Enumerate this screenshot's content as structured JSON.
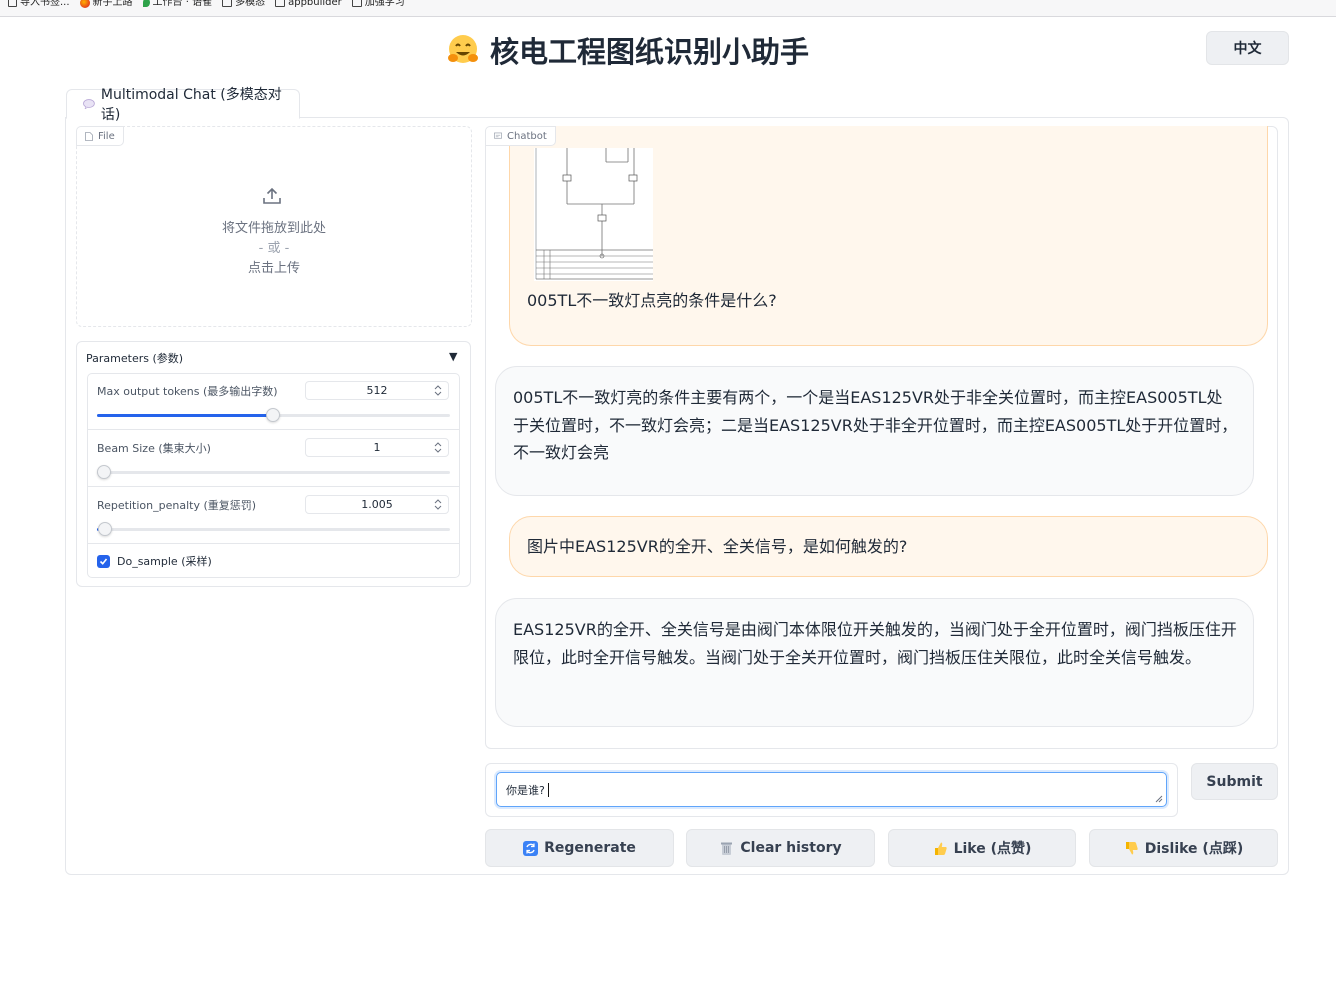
{
  "bookmarks": [
    {
      "label": "导入书签...",
      "icon": "import-icon"
    },
    {
      "label": "新手上路",
      "icon": "firefox-icon"
    },
    {
      "label": "工作台 · 语雀",
      "icon": "leaf-icon"
    },
    {
      "label": "多模态",
      "icon": "folder-icon"
    },
    {
      "label": "appbuilder",
      "icon": "folder-icon"
    },
    {
      "label": "加强学习",
      "icon": "folder-icon"
    }
  ],
  "header": {
    "title": "核电工程图纸识别小助手",
    "icon": "hugging-face-emoji-icon",
    "lang_button": "中文"
  },
  "tab": {
    "label": "Multimodal Chat (多模态对话)",
    "icon": "speech-bubble-icon"
  },
  "file_upload": {
    "label": "File",
    "drop_text": "将文件拖放到此处",
    "or_text": "- 或 -",
    "click_text": "点击上传"
  },
  "parameters": {
    "title": "Parameters (参数)",
    "max_tokens": {
      "label": "Max output tokens (最多输出字数)",
      "value": "512",
      "fraction": 0.5
    },
    "beam_size": {
      "label": "Beam Size (集束大小)",
      "value": "1",
      "fraction": 0.0
    },
    "repetition_penalty": {
      "label": "Repetition_penalty (重复惩罚)",
      "value": "1.005",
      "fraction": 0.005
    },
    "do_sample": {
      "label": "Do_sample (采样)",
      "checked": true
    }
  },
  "chatbot": {
    "label": "Chatbot",
    "messages": [
      {
        "role": "user",
        "text": "005TL不一致灯点亮的条件是什么?"
      },
      {
        "role": "bot",
        "text": "005TL不一致灯亮的条件主要有两个，一个是当EAS125VR处于非全关位置时，而主控EAS005TL处于关位置时，不一致灯会亮；二是当EAS125VR处于非全开位置时，而主控EAS005TL处于开位置时，不一致灯会亮"
      },
      {
        "role": "user",
        "text": "图片中EAS125VR的全开、全关信号，是如何触发的?"
      },
      {
        "role": "bot",
        "text": "EAS125VR的全开、全关信号是由阀门本体限位开关触发的，当阀门处于全开位置时，阀门挡板压住开限位，此时全开信号触发。当阀门处于全关开位置时，阀门挡板压住关限位，此时全关信号触发。"
      }
    ]
  },
  "input": {
    "value": "你是谁?",
    "submit_label": "Submit"
  },
  "actions": {
    "regenerate": "Regenerate",
    "clear": "Clear history",
    "like": "Like (点赞)",
    "dislike": "Dislike (点踩)"
  },
  "colors": {
    "accent": "#2563eb",
    "user_bubble": "#fff7ed",
    "bot_bubble": "#f9fafb"
  }
}
